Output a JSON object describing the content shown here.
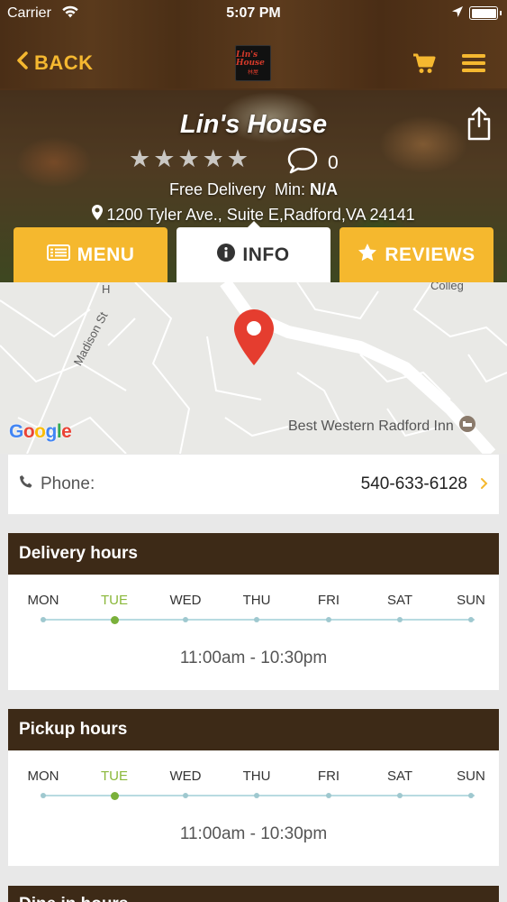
{
  "status_bar": {
    "carrier": "Carrier",
    "time": "5:07 PM",
    "icons": [
      "wifi-icon",
      "location-arrow-icon",
      "battery-icon"
    ]
  },
  "nav": {
    "back_label": "BACK",
    "logo_text": "Lin's House",
    "logo_subtext": "林屋",
    "icons": [
      "cart-icon",
      "hamburger-menu-icon"
    ],
    "accent_color": "#f5b82e"
  },
  "restaurant": {
    "name": "Lin's House",
    "rating": 0,
    "rating_max": 5,
    "review_count": "0",
    "delivery_text": "Free Delivery",
    "min_label": "Min:",
    "min_value": "N/A",
    "address": "1200 Tyler Ave., Suite E,Radford,VA 24141"
  },
  "tabs": {
    "menu": "MENU",
    "info": "INFO",
    "reviews": "REVIEWS",
    "active": "info"
  },
  "map": {
    "street_label_1": "Madison St",
    "street_label_2": "H",
    "street_label_3": "Colleg",
    "poi": "Best Western Radford Inn",
    "google": "Google"
  },
  "phone": {
    "label": "Phone:",
    "value": "540-633-6128"
  },
  "delivery_hours": {
    "title": "Delivery hours",
    "days": [
      "MON",
      "TUE",
      "WED",
      "THU",
      "FRI",
      "SAT",
      "SUN"
    ],
    "active_day": "TUE",
    "hours": "11:00am - 10:30pm"
  },
  "pickup_hours": {
    "title": "Pickup hours",
    "days": [
      "MON",
      "TUE",
      "WED",
      "THU",
      "FRI",
      "SAT",
      "SUN"
    ],
    "active_day": "TUE",
    "hours": "11:00am - 10:30pm"
  },
  "next_section": {
    "title": "Dine in hours"
  },
  "colors": {
    "header_brown": "#4e3118",
    "section_brown": "#3d2a17",
    "active_day_green": "#8ab83a",
    "timeline_blue": "#b8dbe1"
  }
}
